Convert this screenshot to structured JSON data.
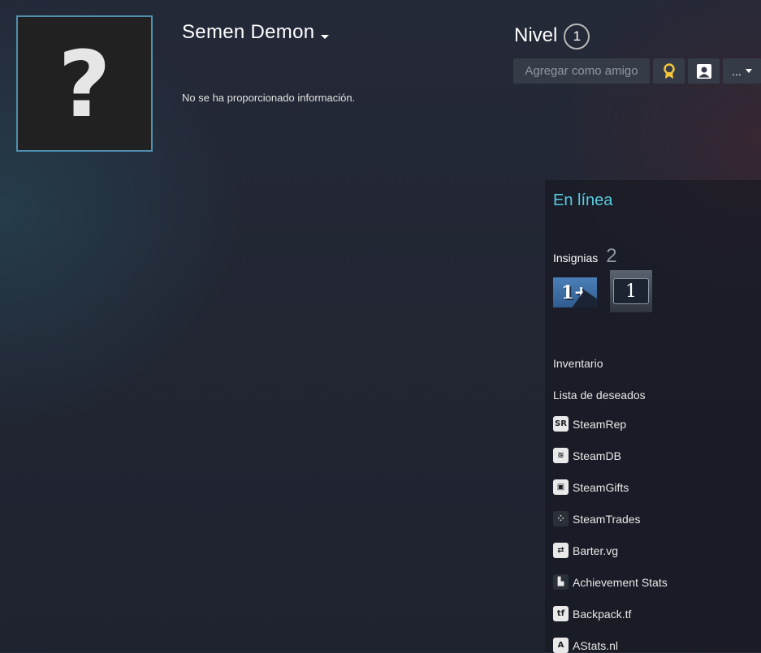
{
  "profile": {
    "persona_name": "Semen Demon",
    "summary": "No se ha proporcionado información.",
    "avatar_glyph": "?"
  },
  "level": {
    "label": "Nivel",
    "value": "1"
  },
  "actions": {
    "add_friend": "Agregar como amigo",
    "more": "..."
  },
  "status": {
    "text": "En línea",
    "color": "#57cbde"
  },
  "badges": {
    "label": "Insignias",
    "count": "2",
    "items": [
      {
        "glyph": "1+"
      },
      {
        "glyph": "1"
      }
    ]
  },
  "links": {
    "inventory": "Inventario",
    "wishlist": "Lista de deseados"
  },
  "external_links": [
    {
      "label": "SteamRep",
      "icon": "SR"
    },
    {
      "label": "SteamDB",
      "icon": "≋"
    },
    {
      "label": "SteamGifts",
      "icon": "▣"
    },
    {
      "label": "SteamTrades",
      "icon": "⁘"
    },
    {
      "label": "Barter.vg",
      "icon": "⇄"
    },
    {
      "label": "Achievement Stats",
      "icon": "▙"
    },
    {
      "label": "Backpack.tf",
      "icon": "tf"
    },
    {
      "label": "AStats.nl",
      "icon": "A"
    }
  ]
}
